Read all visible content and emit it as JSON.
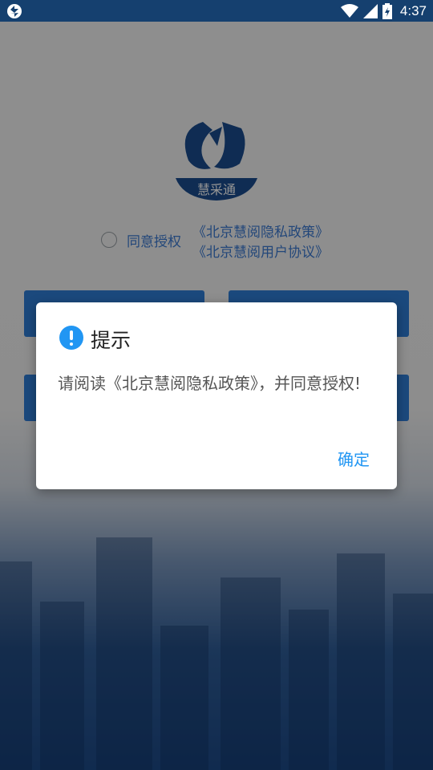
{
  "status_bar": {
    "time": "4:37",
    "icons": [
      "app-notification-icon",
      "wifi-icon",
      "signal-icon",
      "battery-icon"
    ]
  },
  "app": {
    "logo_text": "慧采通",
    "agreement": {
      "label": "同意授权",
      "privacy_policy_link": "《北京慧阅隐私政策》",
      "user_agreement_link": "《北京慧阅用户协议》"
    }
  },
  "dialog": {
    "title": "提示",
    "message": "请阅读《北京慧阅隐私政策》，并同意授权!",
    "confirm_label": "确定"
  },
  "colors": {
    "accent": "#2196f3",
    "status_bar": "#15406f",
    "link": "#3d7bd2"
  }
}
